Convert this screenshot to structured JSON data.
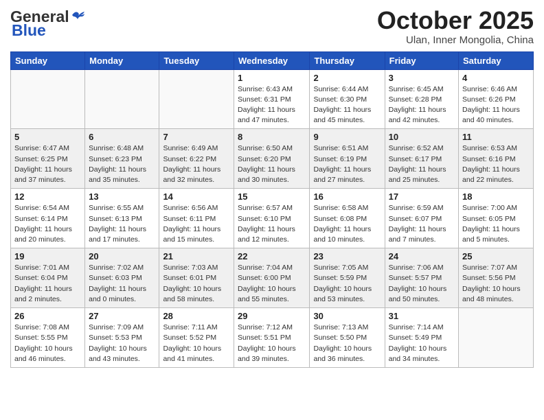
{
  "header": {
    "logo_line1": "General",
    "logo_line2": "Blue",
    "month_title": "October 2025",
    "location": "Ulan, Inner Mongolia, China"
  },
  "weekdays": [
    "Sunday",
    "Monday",
    "Tuesday",
    "Wednesday",
    "Thursday",
    "Friday",
    "Saturday"
  ],
  "weeks": [
    [
      {
        "day": "",
        "info": ""
      },
      {
        "day": "",
        "info": ""
      },
      {
        "day": "",
        "info": ""
      },
      {
        "day": "1",
        "info": "Sunrise: 6:43 AM\nSunset: 6:31 PM\nDaylight: 11 hours\nand 47 minutes."
      },
      {
        "day": "2",
        "info": "Sunrise: 6:44 AM\nSunset: 6:30 PM\nDaylight: 11 hours\nand 45 minutes."
      },
      {
        "day": "3",
        "info": "Sunrise: 6:45 AM\nSunset: 6:28 PM\nDaylight: 11 hours\nand 42 minutes."
      },
      {
        "day": "4",
        "info": "Sunrise: 6:46 AM\nSunset: 6:26 PM\nDaylight: 11 hours\nand 40 minutes."
      }
    ],
    [
      {
        "day": "5",
        "info": "Sunrise: 6:47 AM\nSunset: 6:25 PM\nDaylight: 11 hours\nand 37 minutes."
      },
      {
        "day": "6",
        "info": "Sunrise: 6:48 AM\nSunset: 6:23 PM\nDaylight: 11 hours\nand 35 minutes."
      },
      {
        "day": "7",
        "info": "Sunrise: 6:49 AM\nSunset: 6:22 PM\nDaylight: 11 hours\nand 32 minutes."
      },
      {
        "day": "8",
        "info": "Sunrise: 6:50 AM\nSunset: 6:20 PM\nDaylight: 11 hours\nand 30 minutes."
      },
      {
        "day": "9",
        "info": "Sunrise: 6:51 AM\nSunset: 6:19 PM\nDaylight: 11 hours\nand 27 minutes."
      },
      {
        "day": "10",
        "info": "Sunrise: 6:52 AM\nSunset: 6:17 PM\nDaylight: 11 hours\nand 25 minutes."
      },
      {
        "day": "11",
        "info": "Sunrise: 6:53 AM\nSunset: 6:16 PM\nDaylight: 11 hours\nand 22 minutes."
      }
    ],
    [
      {
        "day": "12",
        "info": "Sunrise: 6:54 AM\nSunset: 6:14 PM\nDaylight: 11 hours\nand 20 minutes."
      },
      {
        "day": "13",
        "info": "Sunrise: 6:55 AM\nSunset: 6:13 PM\nDaylight: 11 hours\nand 17 minutes."
      },
      {
        "day": "14",
        "info": "Sunrise: 6:56 AM\nSunset: 6:11 PM\nDaylight: 11 hours\nand 15 minutes."
      },
      {
        "day": "15",
        "info": "Sunrise: 6:57 AM\nSunset: 6:10 PM\nDaylight: 11 hours\nand 12 minutes."
      },
      {
        "day": "16",
        "info": "Sunrise: 6:58 AM\nSunset: 6:08 PM\nDaylight: 11 hours\nand 10 minutes."
      },
      {
        "day": "17",
        "info": "Sunrise: 6:59 AM\nSunset: 6:07 PM\nDaylight: 11 hours\nand 7 minutes."
      },
      {
        "day": "18",
        "info": "Sunrise: 7:00 AM\nSunset: 6:05 PM\nDaylight: 11 hours\nand 5 minutes."
      }
    ],
    [
      {
        "day": "19",
        "info": "Sunrise: 7:01 AM\nSunset: 6:04 PM\nDaylight: 11 hours\nand 2 minutes."
      },
      {
        "day": "20",
        "info": "Sunrise: 7:02 AM\nSunset: 6:03 PM\nDaylight: 11 hours\nand 0 minutes."
      },
      {
        "day": "21",
        "info": "Sunrise: 7:03 AM\nSunset: 6:01 PM\nDaylight: 10 hours\nand 58 minutes."
      },
      {
        "day": "22",
        "info": "Sunrise: 7:04 AM\nSunset: 6:00 PM\nDaylight: 10 hours\nand 55 minutes."
      },
      {
        "day": "23",
        "info": "Sunrise: 7:05 AM\nSunset: 5:59 PM\nDaylight: 10 hours\nand 53 minutes."
      },
      {
        "day": "24",
        "info": "Sunrise: 7:06 AM\nSunset: 5:57 PM\nDaylight: 10 hours\nand 50 minutes."
      },
      {
        "day": "25",
        "info": "Sunrise: 7:07 AM\nSunset: 5:56 PM\nDaylight: 10 hours\nand 48 minutes."
      }
    ],
    [
      {
        "day": "26",
        "info": "Sunrise: 7:08 AM\nSunset: 5:55 PM\nDaylight: 10 hours\nand 46 minutes."
      },
      {
        "day": "27",
        "info": "Sunrise: 7:09 AM\nSunset: 5:53 PM\nDaylight: 10 hours\nand 43 minutes."
      },
      {
        "day": "28",
        "info": "Sunrise: 7:11 AM\nSunset: 5:52 PM\nDaylight: 10 hours\nand 41 minutes."
      },
      {
        "day": "29",
        "info": "Sunrise: 7:12 AM\nSunset: 5:51 PM\nDaylight: 10 hours\nand 39 minutes."
      },
      {
        "day": "30",
        "info": "Sunrise: 7:13 AM\nSunset: 5:50 PM\nDaylight: 10 hours\nand 36 minutes."
      },
      {
        "day": "31",
        "info": "Sunrise: 7:14 AM\nSunset: 5:49 PM\nDaylight: 10 hours\nand 34 minutes."
      },
      {
        "day": "",
        "info": ""
      }
    ]
  ]
}
